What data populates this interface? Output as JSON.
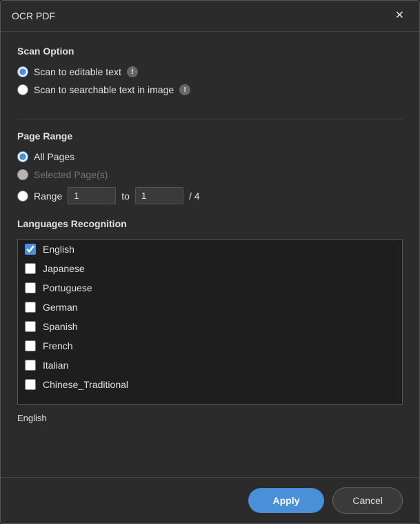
{
  "dialog": {
    "title": "OCR PDF"
  },
  "close_button": "✕",
  "scan_option": {
    "section_title": "Scan Option",
    "options": [
      {
        "id": "editable",
        "label": "Scan to editable text",
        "checked": true,
        "has_info": true
      },
      {
        "id": "searchable",
        "label": "Scan to searchable text in image",
        "checked": false,
        "has_info": true
      }
    ]
  },
  "page_range": {
    "section_title": "Page Range",
    "options": [
      {
        "id": "all",
        "label": "All Pages",
        "checked": true
      },
      {
        "id": "selected",
        "label": "Selected Page(s)",
        "checked": false,
        "disabled": true
      },
      {
        "id": "range",
        "label": "Range",
        "checked": false
      }
    ],
    "range_from": "1",
    "range_to": "1",
    "range_label_to": "to",
    "total_pages": "/ 4"
  },
  "languages": {
    "section_title": "Languages Recognition",
    "items": [
      {
        "id": "english",
        "label": "English",
        "checked": true
      },
      {
        "id": "japanese",
        "label": "Japanese",
        "checked": false
      },
      {
        "id": "portuguese",
        "label": "Portuguese",
        "checked": false
      },
      {
        "id": "german",
        "label": "German",
        "checked": false
      },
      {
        "id": "spanish",
        "label": "Spanish",
        "checked": false
      },
      {
        "id": "french",
        "label": "French",
        "checked": false
      },
      {
        "id": "italian",
        "label": "Italian",
        "checked": false
      },
      {
        "id": "chinese_traditional",
        "label": "Chinese_Traditional",
        "checked": false
      }
    ],
    "selected_display": "English"
  },
  "footer": {
    "apply_label": "Apply",
    "cancel_label": "Cancel"
  }
}
